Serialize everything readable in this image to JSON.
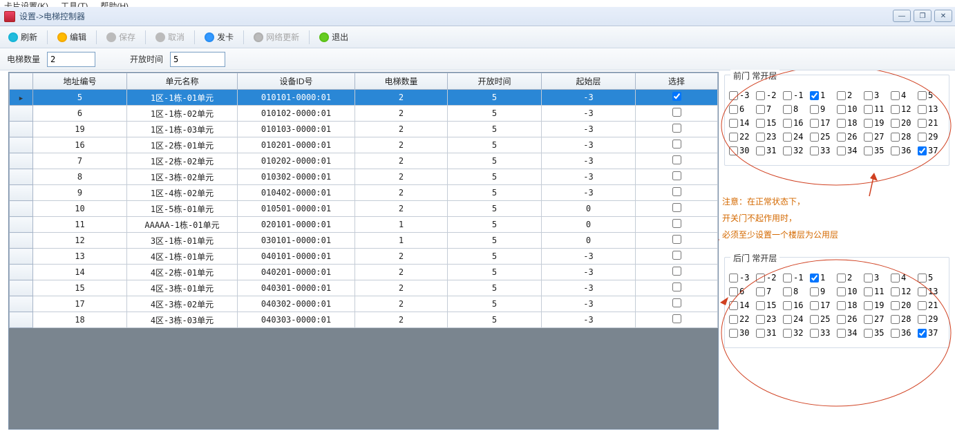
{
  "menu": {
    "items": [
      "卡片设置(K)",
      "工具(T)",
      "帮助(H)"
    ]
  },
  "window": {
    "title_prefix": "设置-> ",
    "title": "电梯控制器"
  },
  "toolbar": {
    "refresh": "刷新",
    "edit": "编辑",
    "save": "保存",
    "cancel": "取消",
    "send": "发卡",
    "netupdate": "网络更新",
    "exit": "退出"
  },
  "params": {
    "elev_count_label": "电梯数量",
    "elev_count_value": "2",
    "open_time_label": "开放时间",
    "open_time_value": "5"
  },
  "grid": {
    "headers": [
      "地址编号",
      "单元名称",
      "设备ID号",
      "电梯数量",
      "开放时间",
      "起始层",
      "选择"
    ],
    "rows": [
      {
        "addr": "5",
        "unit": "1区-1栋-01单元",
        "dev": "010101-0000:01",
        "cnt": "2",
        "open": "5",
        "start": "-3",
        "sel": true
      },
      {
        "addr": "6",
        "unit": "1区-1栋-02单元",
        "dev": "010102-0000:01",
        "cnt": "2",
        "open": "5",
        "start": "-3",
        "sel": false
      },
      {
        "addr": "19",
        "unit": "1区-1栋-03单元",
        "dev": "010103-0000:01",
        "cnt": "2",
        "open": "5",
        "start": "-3",
        "sel": false
      },
      {
        "addr": "16",
        "unit": "1区-2栋-01单元",
        "dev": "010201-0000:01",
        "cnt": "2",
        "open": "5",
        "start": "-3",
        "sel": false
      },
      {
        "addr": "7",
        "unit": "1区-2栋-02单元",
        "dev": "010202-0000:01",
        "cnt": "2",
        "open": "5",
        "start": "-3",
        "sel": false
      },
      {
        "addr": "8",
        "unit": "1区-3栋-02单元",
        "dev": "010302-0000:01",
        "cnt": "2",
        "open": "5",
        "start": "-3",
        "sel": false
      },
      {
        "addr": "9",
        "unit": "1区-4栋-02单元",
        "dev": "010402-0000:01",
        "cnt": "2",
        "open": "5",
        "start": "-3",
        "sel": false
      },
      {
        "addr": "10",
        "unit": "1区-5栋-01单元",
        "dev": "010501-0000:01",
        "cnt": "2",
        "open": "5",
        "start": "0",
        "sel": false
      },
      {
        "addr": "11",
        "unit": "AAAAA-1栋-01单元",
        "dev": "020101-0000:01",
        "cnt": "1",
        "open": "5",
        "start": "0",
        "sel": false
      },
      {
        "addr": "12",
        "unit": "3区-1栋-01单元",
        "dev": "030101-0000:01",
        "cnt": "1",
        "open": "5",
        "start": "0",
        "sel": false
      },
      {
        "addr": "13",
        "unit": "4区-1栋-01单元",
        "dev": "040101-0000:01",
        "cnt": "2",
        "open": "5",
        "start": "-3",
        "sel": false
      },
      {
        "addr": "14",
        "unit": "4区-2栋-01单元",
        "dev": "040201-0000:01",
        "cnt": "2",
        "open": "5",
        "start": "-3",
        "sel": false
      },
      {
        "addr": "15",
        "unit": "4区-3栋-01单元",
        "dev": "040301-0000:01",
        "cnt": "2",
        "open": "5",
        "start": "-3",
        "sel": false
      },
      {
        "addr": "17",
        "unit": "4区-3栋-02单元",
        "dev": "040302-0000:01",
        "cnt": "2",
        "open": "5",
        "start": "-3",
        "sel": false
      },
      {
        "addr": "18",
        "unit": "4区-3栋-03单元",
        "dev": "040303-0000:01",
        "cnt": "2",
        "open": "5",
        "start": "-3",
        "sel": false
      }
    ],
    "selected_index": 0
  },
  "front": {
    "legend": "前门 常开层",
    "floors": [
      [
        "-3",
        "-2",
        "-1",
        "1",
        "2",
        "3",
        "4",
        "5"
      ],
      [
        "6",
        "7",
        "8",
        "9",
        "10",
        "11",
        "12",
        "13"
      ],
      [
        "14",
        "15",
        "16",
        "17",
        "18",
        "19",
        "20",
        "21"
      ],
      [
        "22",
        "23",
        "24",
        "25",
        "26",
        "27",
        "28",
        "29"
      ],
      [
        "30",
        "31",
        "32",
        "33",
        "34",
        "35",
        "36",
        "37"
      ]
    ],
    "checked": [
      "1",
      "37"
    ]
  },
  "back": {
    "legend": "后门 常开层",
    "floors": [
      [
        "-3",
        "-2",
        "-1",
        "1",
        "2",
        "3",
        "4",
        "5"
      ],
      [
        "6",
        "7",
        "8",
        "9",
        "10",
        "11",
        "12",
        "13"
      ],
      [
        "14",
        "15",
        "16",
        "17",
        "18",
        "19",
        "20",
        "21"
      ],
      [
        "22",
        "23",
        "24",
        "25",
        "26",
        "27",
        "28",
        "29"
      ],
      [
        "30",
        "31",
        "32",
        "33",
        "34",
        "35",
        "36",
        "37"
      ]
    ],
    "checked": [
      "1",
      "37"
    ]
  },
  "note": {
    "l1": "注意：在正常状态下，",
    "l2": "开关门不起作用时，",
    "l3": "必须至少设置一个楼层为公用层"
  }
}
